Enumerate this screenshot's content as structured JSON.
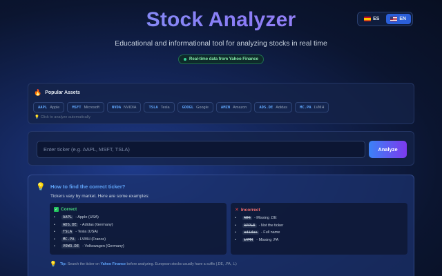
{
  "header": {
    "title": "Stock Analyzer",
    "subtitle": "Educational and informational tool for analyzing stocks in real time",
    "badge": "Real-time data from Yahoo Finance"
  },
  "language": {
    "options": [
      {
        "code": "ES",
        "flag": "flag-es-icon",
        "active": false
      },
      {
        "code": "EN",
        "flag": "flag-us-icon",
        "active": true
      }
    ]
  },
  "popular": {
    "title": "Popular Assets",
    "hint": "Click to analyze automatically",
    "assets": [
      {
        "ticker": "AAPL",
        "name": "Apple"
      },
      {
        "ticker": "MSFT",
        "name": "Microsoft"
      },
      {
        "ticker": "NVDA",
        "name": "NVIDIA"
      },
      {
        "ticker": "TSLA",
        "name": "Tesla"
      },
      {
        "ticker": "GOOGL",
        "name": "Google"
      },
      {
        "ticker": "AMZN",
        "name": "Amazon"
      },
      {
        "ticker": "ADS.DE",
        "name": "Adidas"
      },
      {
        "ticker": "MC.PA",
        "name": "LVMH"
      }
    ]
  },
  "search": {
    "placeholder": "Enter ticker (e.g. AAPL, MSFT, TSLA)",
    "value": "",
    "button": "Analyze"
  },
  "help": {
    "title": "How to find the correct ticker?",
    "description": "Tickers vary by market. Here are some examples:",
    "correct": {
      "title": "Correct",
      "items": [
        {
          "code": "AAPL",
          "note": "- Apple (USA)"
        },
        {
          "code": "ADS.DE",
          "note": "- Adidas (Germany)"
        },
        {
          "code": "TSLA",
          "note": "- Tesla (USA)"
        },
        {
          "code": "MC.PA",
          "note": "- LVMH (France)"
        },
        {
          "code": "VOW3.DE",
          "note": "- Volkswagen (Germany)"
        }
      ]
    },
    "incorrect": {
      "title": "Incorrect",
      "items": [
        {
          "code": "ADS",
          "note": "- Missing .DE"
        },
        {
          "code": "APPLE",
          "note": "- Not the ticker"
        },
        {
          "code": "adidas",
          "note": "- Full name"
        },
        {
          "code": "LVMH",
          "note": "- Missing .PA"
        }
      ]
    },
    "tip": {
      "label": "Tip:",
      "before": "Search the ticker on",
      "link": "Yahoo Finance",
      "after": "before analyzing. European stocks usually have a suffix (.DE, .PA, .L)"
    }
  },
  "colors": {
    "accent": "#60a5fa",
    "button_start": "#3b82f6",
    "button_end": "#7c3aed",
    "correct": "#4ade80",
    "incorrect": "#f87171",
    "live": "#34d399"
  }
}
